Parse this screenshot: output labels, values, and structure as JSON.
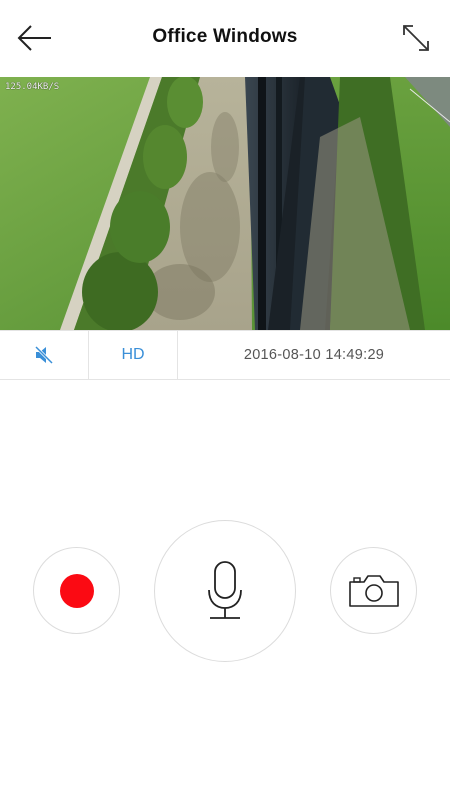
{
  "header": {
    "title": "Office Windows",
    "back_icon": "arrow-left-icon",
    "fullscreen_icon": "expand-diagonal-icon"
  },
  "video": {
    "bitrate_overlay": "125.04KB/S"
  },
  "controls": {
    "mute_icon": "speaker-muted-icon",
    "quality_label": "HD",
    "timestamp": "2016-08-10 14:49:29"
  },
  "actions": {
    "record_icon": "record-dot-icon",
    "talk_icon": "microphone-icon",
    "snapshot_icon": "camera-icon"
  },
  "colors": {
    "accent": "#3a8fd8",
    "record": "#fb0a13",
    "divider": "#e4e4e4",
    "title": "#111111",
    "timestamp": "#555555"
  }
}
